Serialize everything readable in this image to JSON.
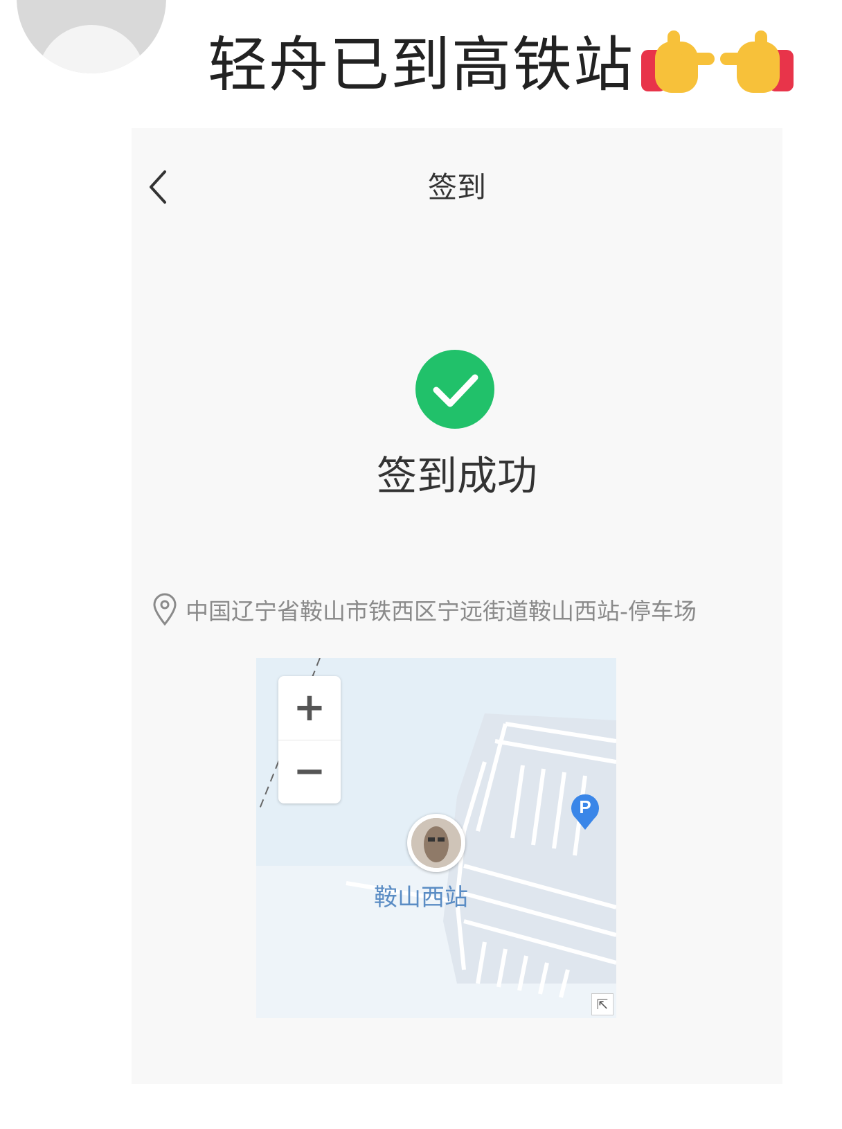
{
  "post": {
    "caption": "轻舟已到高铁站",
    "emoji": [
      "pointing-right-hand-icon",
      "pointing-left-hand-icon"
    ]
  },
  "checkin_screen": {
    "nav": {
      "title": "签到",
      "back_icon": "chevron-left-icon"
    },
    "status": {
      "icon": "check-circle-icon",
      "text": "签到成功",
      "color": "#21c16a"
    },
    "location": {
      "icon": "location-pin-icon",
      "address": "中国辽宁省鞍山市铁西区宁远街道鞍山西站-停车场"
    },
    "map": {
      "zoom_in_label": "+",
      "zoom_out_label": "−",
      "station_label": "鞍山西站",
      "poi": {
        "label": "P",
        "icon": "parking-marker-icon",
        "color": "#3a86e8"
      },
      "expand_label": "⇱"
    }
  }
}
